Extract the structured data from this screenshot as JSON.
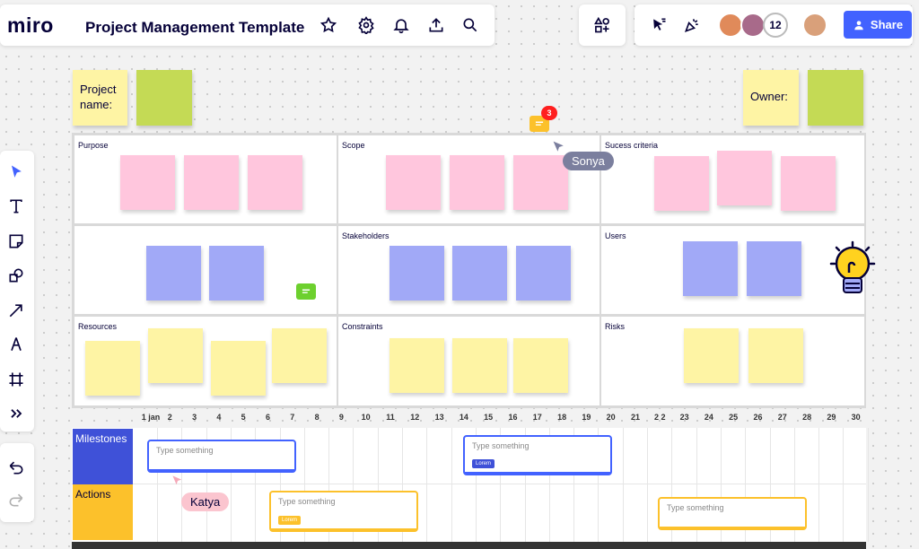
{
  "app": {
    "logo": "miro",
    "board_title": "Project Management Template"
  },
  "topbar": {
    "icons": [
      "star-icon",
      "settings-icon",
      "bell-icon",
      "upload-icon",
      "search-icon"
    ],
    "apps_icon": "apps-add-icon",
    "collab_icons": [
      "pointer-select-icon",
      "celebrate-icon"
    ],
    "collaborator_count": "12",
    "share_label": "Share"
  },
  "toolbar": {
    "tools": [
      "select-icon",
      "text-icon",
      "sticky-note-icon",
      "shapes-icon",
      "arrow-icon",
      "pen-icon",
      "frame-icon",
      "more-icon"
    ],
    "undo": "undo-icon",
    "redo": "redo-icon"
  },
  "header": {
    "project_name_label": "Project name:",
    "owner_label": "Owner:"
  },
  "grid": {
    "purpose": "Purpose",
    "scope": "Scope",
    "success": "Sucess criteria",
    "stakeholders": "Stakeholders",
    "users": "Users",
    "resources": "Resources",
    "constraints": "Constraints",
    "risks": "Risks"
  },
  "timeline": {
    "days": [
      "1 jan",
      "2",
      "3",
      "4",
      "5",
      "6",
      "7",
      "8",
      "9",
      "10",
      "11",
      "12",
      "13",
      "14",
      "15",
      "16",
      "17",
      "18",
      "19",
      "20",
      "21",
      "2 2",
      "23",
      "24",
      "25",
      "26",
      "27",
      "28",
      "29",
      "30"
    ],
    "milestones_label": "Milestones",
    "actions_label": "Actions",
    "cards": [
      {
        "placeholder": "Type something",
        "tag": ""
      },
      {
        "placeholder": "Type something",
        "tag": "Lorem"
      },
      {
        "placeholder": "Type something",
        "tag": "Lorem"
      },
      {
        "placeholder": "Type something",
        "tag": ""
      }
    ]
  },
  "cursors": {
    "sonya": "Sonya",
    "katya": "Katya"
  },
  "comments": {
    "badge_count": "3"
  },
  "colors": {
    "accent": "#4262ff",
    "pink": "#ffc6dd",
    "blue": "#a1a9f7",
    "yellow": "#fef4a4",
    "green": "#c4da55",
    "milestones": "#3f51d8",
    "actions": "#fcc12b"
  }
}
